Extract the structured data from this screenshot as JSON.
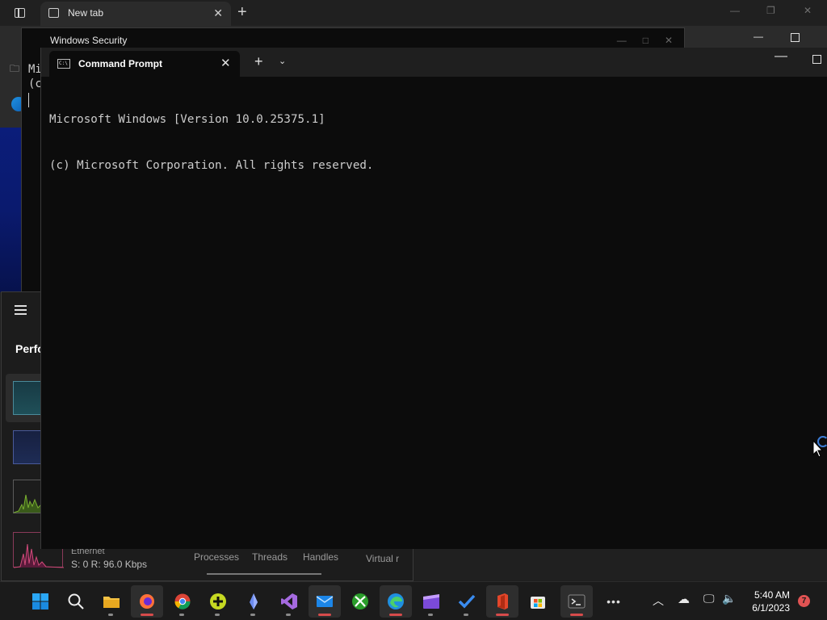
{
  "browser": {
    "tab_title": "New tab",
    "tab_close_icon": "close-icon",
    "new_tab_icon": "plus-icon"
  },
  "background_terminal": {
    "title": "Windows Security",
    "text_lines": [
      "Mi",
      "(c"
    ]
  },
  "task_manager": {
    "heading": "Perfo",
    "ethernet_label": "Ethernet",
    "ethernet_value": "S: 0 R: 96.0 Kbps",
    "tabs": [
      "Processes",
      "Threads",
      "Handles",
      "Virtual r"
    ]
  },
  "cmd": {
    "tab_title": "Command Prompt",
    "lines": [
      "Microsoft Windows [Version 10.0.25375.1]",
      "(c) Microsoft Corporation. All rights reserved."
    ]
  },
  "taskbar": {
    "apps": [
      "start",
      "search",
      "file-explorer",
      "firefox",
      "chrome",
      "plus-app",
      "unknown-app",
      "visual-studio",
      "mail",
      "xbox",
      "edge",
      "clipchamp",
      "todo",
      "office",
      "store",
      "terminal"
    ],
    "overflow_label": "•••",
    "time": "5:40 AM",
    "date": "6/1/2023",
    "notification_count": "7"
  },
  "colors": {
    "terminal_bg": "#0c0c0c",
    "terminal_text": "#cccccc",
    "taskbar_bg": "#1b1b1b",
    "badge": "#e05353"
  }
}
